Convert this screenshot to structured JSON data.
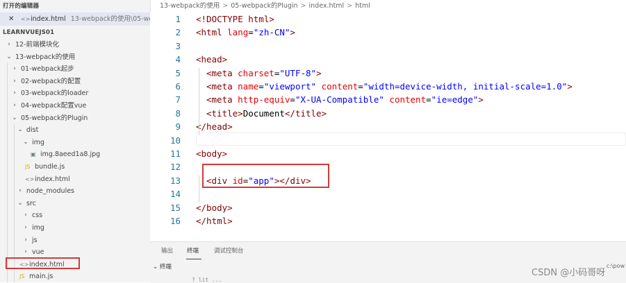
{
  "sidebar": {
    "open_editors_title": "打开的编辑器",
    "open_editor": {
      "close": "✕",
      "icon": "<>",
      "name": "index.html",
      "path": "13-webpack的使用\\05-we..."
    },
    "explorer_title": "LEARNVUEJS01",
    "tree": [
      {
        "label": "12-前端模块化",
        "chev": "›",
        "icon": ""
      },
      {
        "label": "13-webpack的使用",
        "chev": "⌄",
        "icon": ""
      },
      {
        "label": "01-webpack起步",
        "chev": "›",
        "icon": ""
      },
      {
        "label": "02-webpack的配置",
        "chev": "›",
        "icon": ""
      },
      {
        "label": "03-webpack的loader",
        "chev": "›",
        "icon": ""
      },
      {
        "label": "04-webpack配置vue",
        "chev": "›",
        "icon": ""
      },
      {
        "label": "05-webpack的Plugin",
        "chev": "⌄",
        "icon": ""
      },
      {
        "label": "dist",
        "chev": "⌄",
        "icon": ""
      },
      {
        "label": "img",
        "chev": "⌄",
        "icon": ""
      },
      {
        "label": "img.8aeed1a8.jpg",
        "chev": "",
        "icon": "▣"
      },
      {
        "label": "bundle.js",
        "chev": "",
        "icon": "JS"
      },
      {
        "label": "index.html",
        "chev": "",
        "icon": "<>"
      },
      {
        "label": "node_modules",
        "chev": "›",
        "icon": ""
      },
      {
        "label": "src",
        "chev": "⌄",
        "icon": ""
      },
      {
        "label": "css",
        "chev": "›",
        "icon": ""
      },
      {
        "label": "img",
        "chev": "›",
        "icon": ""
      },
      {
        "label": "js",
        "chev": "›",
        "icon": ""
      },
      {
        "label": "vue",
        "chev": "›",
        "icon": ""
      },
      {
        "label": "index.html",
        "chev": "",
        "icon": "<>"
      },
      {
        "label": "main.js",
        "chev": "",
        "icon": "JS"
      }
    ]
  },
  "breadcrumb": [
    "13-webpack的使用",
    "05-webpack的Plugin",
    "index.html",
    "html"
  ],
  "editor": {
    "line_numbers": [
      "1",
      "2",
      "3",
      "4",
      "5",
      "6",
      "7",
      "8",
      "9",
      "10",
      "11",
      "12",
      "13",
      "14",
      "15",
      "16"
    ],
    "lines": [
      {
        "n": 1,
        "indent": 0,
        "parts": [
          [
            "tag",
            "<!DOCTYPE html>"
          ]
        ]
      },
      {
        "n": 2,
        "indent": 0,
        "parts": [
          [
            "tag",
            "<html "
          ],
          [
            "attr",
            "lang"
          ],
          [
            "plain",
            "="
          ],
          [
            "str",
            "\"zh-CN\""
          ],
          [
            "tag",
            ">"
          ]
        ]
      },
      {
        "n": 3,
        "indent": 0,
        "parts": []
      },
      {
        "n": 4,
        "indent": 0,
        "parts": [
          [
            "tag",
            "<head>"
          ]
        ]
      },
      {
        "n": 5,
        "indent": 1,
        "parts": [
          [
            "tag",
            "<meta "
          ],
          [
            "attr",
            "charset"
          ],
          [
            "plain",
            "="
          ],
          [
            "str",
            "\"UTF-8\""
          ],
          [
            "tag",
            ">"
          ]
        ]
      },
      {
        "n": 6,
        "indent": 1,
        "parts": [
          [
            "tag",
            "<meta "
          ],
          [
            "attr",
            "name"
          ],
          [
            "plain",
            "="
          ],
          [
            "str",
            "\"viewport\""
          ],
          [
            "plain",
            " "
          ],
          [
            "attr",
            "content"
          ],
          [
            "plain",
            "="
          ],
          [
            "str",
            "\"width=device-width, initial-scale=1.0\""
          ],
          [
            "tag",
            ">"
          ]
        ]
      },
      {
        "n": 7,
        "indent": 1,
        "parts": [
          [
            "tag",
            "<meta "
          ],
          [
            "attr",
            "http-equiv"
          ],
          [
            "plain",
            "="
          ],
          [
            "str",
            "\"X-UA-Compatible\""
          ],
          [
            "plain",
            " "
          ],
          [
            "attr",
            "content"
          ],
          [
            "plain",
            "="
          ],
          [
            "str",
            "\"ie=edge\""
          ],
          [
            "tag",
            ">"
          ]
        ]
      },
      {
        "n": 8,
        "indent": 1,
        "parts": [
          [
            "tag",
            "<title>"
          ],
          [
            "plain",
            "Document"
          ],
          [
            "tag",
            "</title>"
          ]
        ]
      },
      {
        "n": 9,
        "indent": 0,
        "parts": [
          [
            "tag",
            "</head>"
          ]
        ]
      },
      {
        "n": 10,
        "indent": 0,
        "parts": []
      },
      {
        "n": 11,
        "indent": 0,
        "parts": [
          [
            "tag",
            "<body>"
          ]
        ]
      },
      {
        "n": 12,
        "indent": 0,
        "parts": []
      },
      {
        "n": 13,
        "indent": 1,
        "parts": [
          [
            "tag",
            "<div "
          ],
          [
            "attr",
            "id"
          ],
          [
            "plain",
            "="
          ],
          [
            "str",
            "\"app\""
          ],
          [
            "tag",
            "></div>"
          ]
        ]
      },
      {
        "n": 14,
        "indent": 0,
        "parts": []
      },
      {
        "n": 15,
        "indent": 0,
        "parts": [
          [
            "tag",
            "</body>"
          ]
        ]
      },
      {
        "n": 16,
        "indent": 0,
        "parts": [
          [
            "tag",
            "</html>"
          ]
        ]
      }
    ]
  },
  "panel": {
    "tabs": [
      "输出",
      "终端",
      "调试控制台"
    ],
    "filter_label": "终端",
    "right_text": "c:\\pow",
    "bottom_text": "? lit  ..."
  },
  "watermark": "CSDN @小码哥呀"
}
